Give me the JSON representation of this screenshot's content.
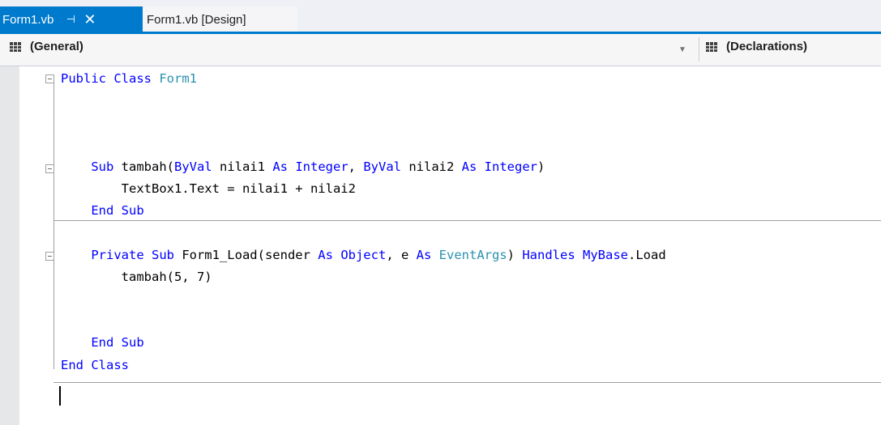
{
  "tabs": [
    {
      "label": "Form1.vb",
      "pin_glyph": "⊣",
      "close_glyph": "✕",
      "active": true
    },
    {
      "label": "Form1.vb [Design]",
      "active": false
    }
  ],
  "navigation": {
    "left_dropdown": "(General)",
    "right_dropdown": "(Declarations)"
  },
  "code_lines": [
    {
      "segments": [
        {
          "t": "Public Class ",
          "c": "kw"
        },
        {
          "t": "Form1",
          "c": "ty"
        }
      ]
    },
    {
      "segments": []
    },
    {
      "segments": []
    },
    {
      "segments": []
    },
    {
      "segments": [
        {
          "t": "    Sub ",
          "c": "kw"
        },
        {
          "t": "tambah(",
          "c": ""
        },
        {
          "t": "ByVal",
          "c": "kw"
        },
        {
          "t": " nilai1 ",
          "c": ""
        },
        {
          "t": "As",
          "c": "kw"
        },
        {
          "t": " ",
          "c": ""
        },
        {
          "t": "Integer",
          "c": "kw"
        },
        {
          "t": ", ",
          "c": ""
        },
        {
          "t": "ByVal",
          "c": "kw"
        },
        {
          "t": " nilai2 ",
          "c": ""
        },
        {
          "t": "As",
          "c": "kw"
        },
        {
          "t": " ",
          "c": ""
        },
        {
          "t": "Integer",
          "c": "kw"
        },
        {
          "t": ")",
          "c": ""
        }
      ]
    },
    {
      "segments": [
        {
          "t": "        TextBox1.Text = nilai1 + nilai2",
          "c": ""
        }
      ]
    },
    {
      "segments": [
        {
          "t": "    End Sub",
          "c": "kw"
        }
      ]
    },
    {
      "segments": []
    },
    {
      "segments": [
        {
          "t": "    Private Sub ",
          "c": "kw"
        },
        {
          "t": "Form1_Load(sender ",
          "c": ""
        },
        {
          "t": "As",
          "c": "kw"
        },
        {
          "t": " ",
          "c": ""
        },
        {
          "t": "Object",
          "c": "kw"
        },
        {
          "t": ", e ",
          "c": ""
        },
        {
          "t": "As",
          "c": "kw"
        },
        {
          "t": " ",
          "c": ""
        },
        {
          "t": "EventArgs",
          "c": "ty"
        },
        {
          "t": ") ",
          "c": ""
        },
        {
          "t": "Handles",
          "c": "kw"
        },
        {
          "t": " ",
          "c": ""
        },
        {
          "t": "MyBase",
          "c": "kw"
        },
        {
          "t": ".Load",
          "c": ""
        }
      ]
    },
    {
      "segments": [
        {
          "t": "        tambah(5, 7)",
          "c": ""
        }
      ]
    },
    {
      "segments": []
    },
    {
      "segments": []
    },
    {
      "segments": [
        {
          "t": "    End Sub",
          "c": "kw"
        }
      ]
    },
    {
      "segments": [
        {
          "t": "End Class",
          "c": "kw"
        }
      ]
    },
    {
      "segments": []
    }
  ],
  "colors": {
    "accent": "#007acc",
    "keyword": "#0000ff",
    "type": "#2b91af"
  }
}
